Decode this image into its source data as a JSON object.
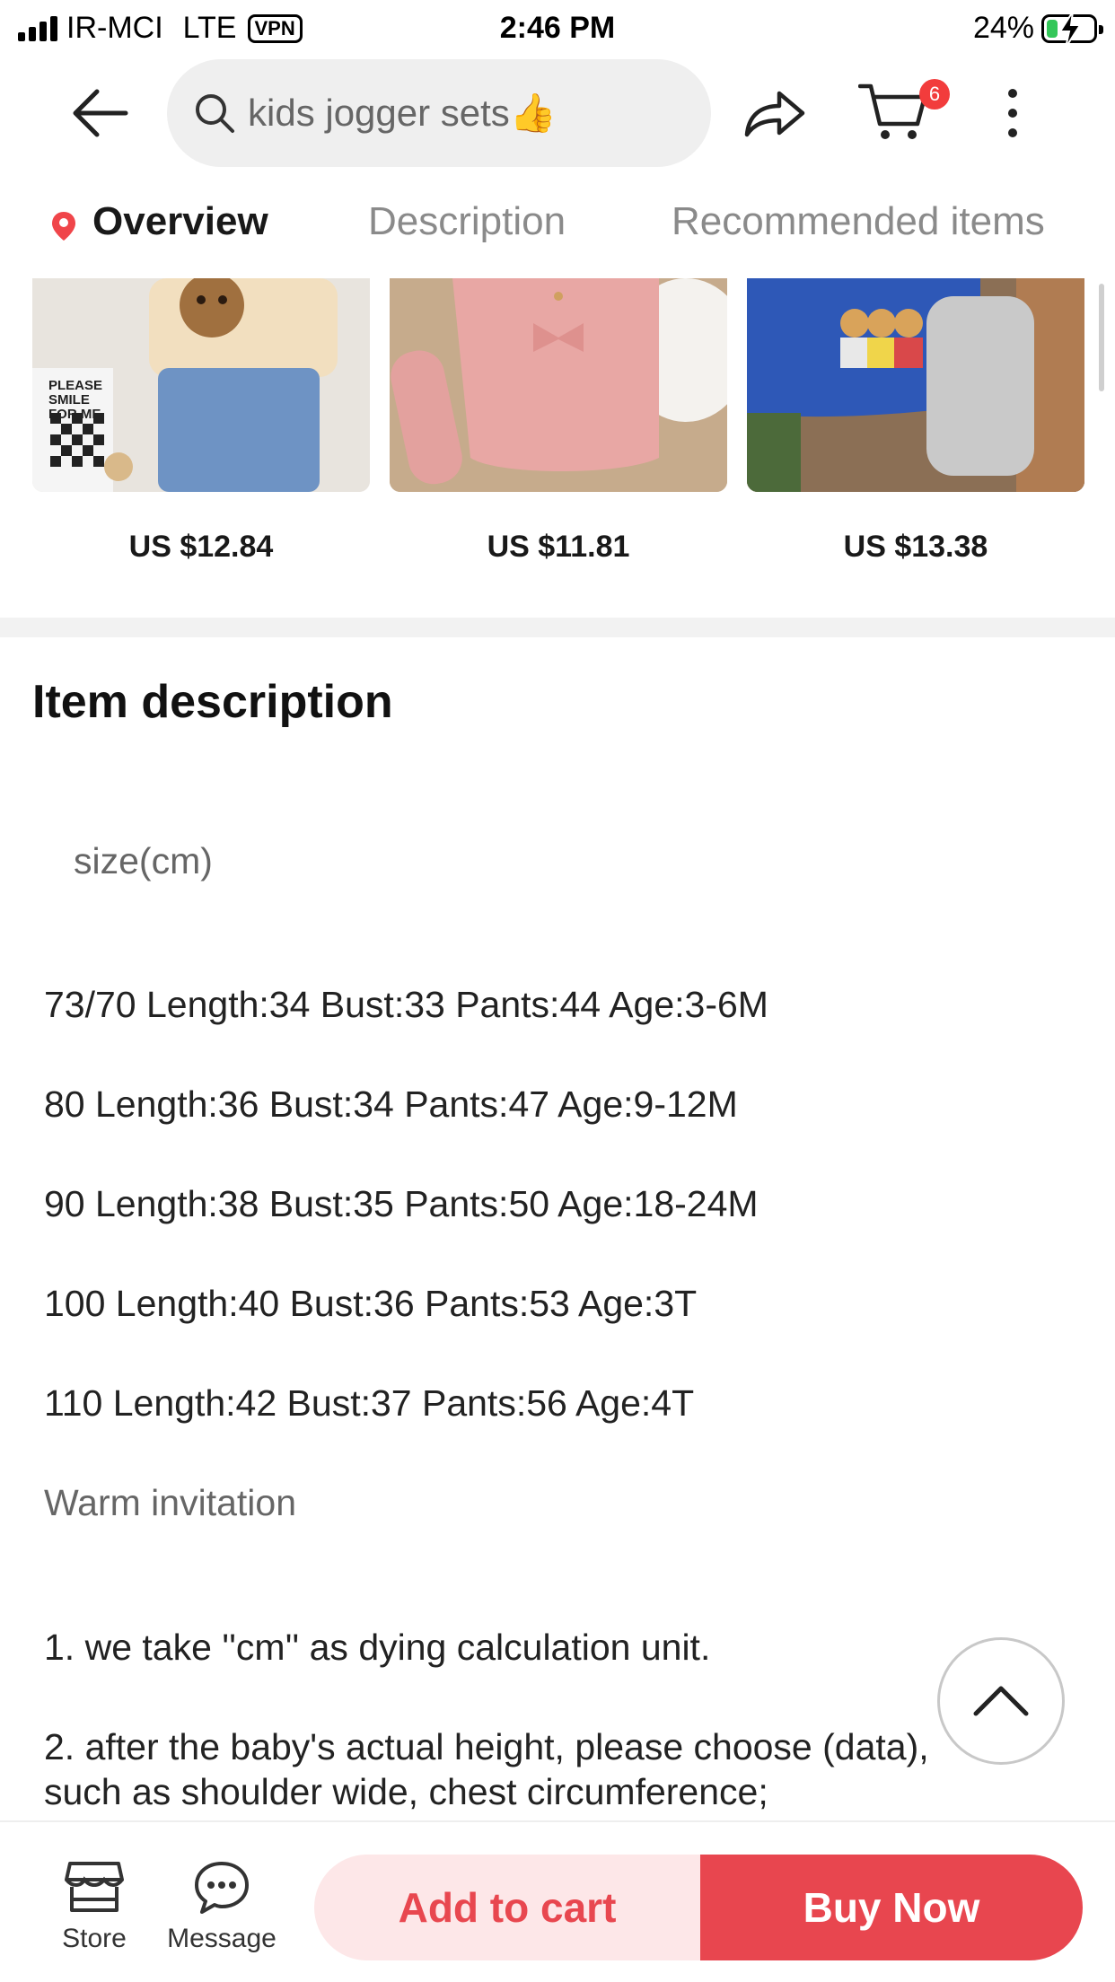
{
  "status_bar": {
    "carrier": "IR-MCI",
    "network": "LTE",
    "vpn": "VPN",
    "time": "2:46 PM",
    "battery": "24%",
    "battery_level": 0.24
  },
  "top_nav": {
    "search_query": "kids jogger sets👍",
    "cart_count": "6"
  },
  "tabs": [
    {
      "label": "Overview",
      "active": true
    },
    {
      "label": "Description",
      "active": false
    },
    {
      "label": "Recommended items",
      "active": false
    }
  ],
  "recommended": [
    {
      "price": "US $12.84",
      "image": "toddler bear sweater with jeans outfit",
      "sign_text": "PLEASE SMILE FOR ME"
    },
    {
      "price": "US $11.81",
      "image": "pink knit ruffled romper with bow and socks"
    },
    {
      "price": "US $13.38",
      "image": "blue bear print sweatshirt with grey joggers"
    }
  ],
  "description": {
    "title": "Item description",
    "size_heading": "size(cm)",
    "size_rows": [
      "73/70 Length:34 Bust:33 Pants:44 Age:3-6M",
      "80 Length:36 Bust:34 Pants:47 Age:9-12M",
      "90 Length:38 Bust:35 Pants:50 Age:18-24M",
      "100 Length:40 Bust:36 Pants:53 Age:3T",
      "110 Length:42 Bust:37 Pants:56 Age:4T"
    ],
    "warm_invitation": "Warm invitation",
    "note_1": "1. we take ''cm'' as dying calculation unit.",
    "note_2a": "2. after the baby's actual height, please choose (data),",
    "note_2b": "such as shoulder wide, chest circumference;"
  },
  "bottom_bar": {
    "store": "Store",
    "message": "Message",
    "add_to_cart": "Add to cart",
    "buy_now": "Buy Now"
  },
  "colors": {
    "accent_red": "#e8464f",
    "accent_pink_bg": "#fde7e8",
    "badge_red": "#f23c3c"
  }
}
